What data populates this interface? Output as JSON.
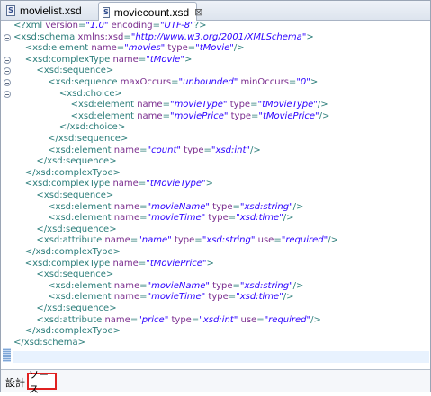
{
  "tabs": [
    {
      "label": "movielist.xsd",
      "icon": "xsd-file-icon",
      "active": false
    },
    {
      "label": "moviecount.xsd",
      "icon": "xsd-file-icon",
      "active": true,
      "close": "⊠"
    }
  ],
  "icon_letter": "S",
  "editor": {
    "lines": [
      [
        {
          "t": "plain",
          "v": "<?xml "
        },
        {
          "t": "attr",
          "v": "version"
        },
        {
          "t": "plain",
          "v": "="
        },
        {
          "t": "val",
          "v": "\"1.0\""
        },
        {
          "t": "plain",
          "v": " "
        },
        {
          "t": "attr",
          "v": "encoding"
        },
        {
          "t": "plain",
          "v": "="
        },
        {
          "t": "val",
          "v": "\"UTF-8\""
        },
        {
          "t": "plain",
          "v": "?>"
        }
      ],
      [
        {
          "t": "tag",
          "v": "<xsd:schema "
        },
        {
          "t": "attr",
          "v": "xmlns:xsd"
        },
        {
          "t": "plain",
          "v": "="
        },
        {
          "t": "val",
          "v": "\"http://www.w3.org/2001/XMLSchema\""
        },
        {
          "t": "tag",
          "v": ">"
        }
      ],
      [
        {
          "t": "tag",
          "v": "    <xsd:element "
        },
        {
          "t": "attr",
          "v": "name"
        },
        {
          "t": "plain",
          "v": "="
        },
        {
          "t": "val",
          "v": "\"movies\""
        },
        {
          "t": "plain",
          "v": " "
        },
        {
          "t": "attr",
          "v": "type"
        },
        {
          "t": "plain",
          "v": "="
        },
        {
          "t": "val",
          "v": "\"tMovie\""
        },
        {
          "t": "tag",
          "v": "/>"
        }
      ],
      [
        {
          "t": "tag",
          "v": "    <xsd:complexType "
        },
        {
          "t": "attr",
          "v": "name"
        },
        {
          "t": "plain",
          "v": "="
        },
        {
          "t": "val",
          "v": "\"tMovie\""
        },
        {
          "t": "tag",
          "v": ">"
        }
      ],
      [
        {
          "t": "tag",
          "v": "        <xsd:sequence>"
        }
      ],
      [
        {
          "t": "tag",
          "v": "            <xsd:sequence "
        },
        {
          "t": "attr",
          "v": "maxOccurs"
        },
        {
          "t": "plain",
          "v": "="
        },
        {
          "t": "val",
          "v": "\"unbounded\""
        },
        {
          "t": "plain",
          "v": " "
        },
        {
          "t": "attr",
          "v": "minOccurs"
        },
        {
          "t": "plain",
          "v": "="
        },
        {
          "t": "val",
          "v": "\"0\""
        },
        {
          "t": "tag",
          "v": ">"
        }
      ],
      [
        {
          "t": "tag",
          "v": "                <xsd:choice>"
        }
      ],
      [
        {
          "t": "tag",
          "v": "                    <xsd:element "
        },
        {
          "t": "attr",
          "v": "name"
        },
        {
          "t": "plain",
          "v": "="
        },
        {
          "t": "val",
          "v": "\"movieType\""
        },
        {
          "t": "plain",
          "v": " "
        },
        {
          "t": "attr",
          "v": "type"
        },
        {
          "t": "plain",
          "v": "="
        },
        {
          "t": "val",
          "v": "\"tMovieType\""
        },
        {
          "t": "tag",
          "v": "/>"
        }
      ],
      [
        {
          "t": "tag",
          "v": "                    <xsd:element "
        },
        {
          "t": "attr",
          "v": "name"
        },
        {
          "t": "plain",
          "v": "="
        },
        {
          "t": "val",
          "v": "\"moviePrice\""
        },
        {
          "t": "plain",
          "v": " "
        },
        {
          "t": "attr",
          "v": "type"
        },
        {
          "t": "plain",
          "v": "="
        },
        {
          "t": "val",
          "v": "\"tMoviePrice\""
        },
        {
          "t": "tag",
          "v": "/>"
        }
      ],
      [
        {
          "t": "tag",
          "v": "                </xsd:choice>"
        }
      ],
      [
        {
          "t": "tag",
          "v": "            </xsd:sequence>"
        }
      ],
      [
        {
          "t": "tag",
          "v": "            <xsd:element "
        },
        {
          "t": "attr",
          "v": "name"
        },
        {
          "t": "plain",
          "v": "="
        },
        {
          "t": "val",
          "v": "\"count\""
        },
        {
          "t": "plain",
          "v": " "
        },
        {
          "t": "attr",
          "v": "type"
        },
        {
          "t": "plain",
          "v": "="
        },
        {
          "t": "val",
          "v": "\"xsd:int\""
        },
        {
          "t": "tag",
          "v": "/>"
        }
      ],
      [
        {
          "t": "tag",
          "v": "        </xsd:sequence>"
        }
      ],
      [
        {
          "t": "tag",
          "v": "    </xsd:complexType>"
        }
      ],
      [
        {
          "t": "tag",
          "v": "    <xsd:complexType "
        },
        {
          "t": "attr",
          "v": "name"
        },
        {
          "t": "plain",
          "v": "="
        },
        {
          "t": "val",
          "v": "\"tMovieType\""
        },
        {
          "t": "tag",
          "v": ">"
        }
      ],
      [
        {
          "t": "tag",
          "v": "        <xsd:sequence>"
        }
      ],
      [
        {
          "t": "tag",
          "v": "            <xsd:element "
        },
        {
          "t": "attr",
          "v": "name"
        },
        {
          "t": "plain",
          "v": "="
        },
        {
          "t": "val",
          "v": "\"movieName\""
        },
        {
          "t": "plain",
          "v": " "
        },
        {
          "t": "attr",
          "v": "type"
        },
        {
          "t": "plain",
          "v": "="
        },
        {
          "t": "val",
          "v": "\"xsd:string\""
        },
        {
          "t": "tag",
          "v": "/>"
        }
      ],
      [
        {
          "t": "tag",
          "v": "            <xsd:element "
        },
        {
          "t": "attr",
          "v": "name"
        },
        {
          "t": "plain",
          "v": "="
        },
        {
          "t": "val",
          "v": "\"movieTime\""
        },
        {
          "t": "plain",
          "v": " "
        },
        {
          "t": "attr",
          "v": "type"
        },
        {
          "t": "plain",
          "v": "="
        },
        {
          "t": "val",
          "v": "\"xsd:time\""
        },
        {
          "t": "tag",
          "v": "/>"
        }
      ],
      [
        {
          "t": "tag",
          "v": "        </xsd:sequence>"
        }
      ],
      [
        {
          "t": "tag",
          "v": "        <xsd:attribute "
        },
        {
          "t": "attr",
          "v": "name"
        },
        {
          "t": "plain",
          "v": "="
        },
        {
          "t": "val",
          "v": "\"name\""
        },
        {
          "t": "plain",
          "v": " "
        },
        {
          "t": "attr",
          "v": "type"
        },
        {
          "t": "plain",
          "v": "="
        },
        {
          "t": "val",
          "v": "\"xsd:string\""
        },
        {
          "t": "plain",
          "v": " "
        },
        {
          "t": "attr",
          "v": "use"
        },
        {
          "t": "plain",
          "v": "="
        },
        {
          "t": "val",
          "v": "\"required\""
        },
        {
          "t": "tag",
          "v": "/>"
        }
      ],
      [
        {
          "t": "tag",
          "v": "    </xsd:complexType>"
        }
      ],
      [
        {
          "t": "tag",
          "v": "    <xsd:complexType "
        },
        {
          "t": "attr",
          "v": "name"
        },
        {
          "t": "plain",
          "v": "="
        },
        {
          "t": "val",
          "v": "\"tMoviePrice\""
        },
        {
          "t": "tag",
          "v": ">"
        }
      ],
      [
        {
          "t": "tag",
          "v": "        <xsd:sequence>"
        }
      ],
      [
        {
          "t": "tag",
          "v": "            <xsd:element "
        },
        {
          "t": "attr",
          "v": "name"
        },
        {
          "t": "plain",
          "v": "="
        },
        {
          "t": "val",
          "v": "\"movieName\""
        },
        {
          "t": "plain",
          "v": " "
        },
        {
          "t": "attr",
          "v": "type"
        },
        {
          "t": "plain",
          "v": "="
        },
        {
          "t": "val",
          "v": "\"xsd:string\""
        },
        {
          "t": "tag",
          "v": "/>"
        }
      ],
      [
        {
          "t": "tag",
          "v": "            <xsd:element "
        },
        {
          "t": "attr",
          "v": "name"
        },
        {
          "t": "plain",
          "v": "="
        },
        {
          "t": "val",
          "v": "\"movieTime\""
        },
        {
          "t": "plain",
          "v": " "
        },
        {
          "t": "attr",
          "v": "type"
        },
        {
          "t": "plain",
          "v": "="
        },
        {
          "t": "val",
          "v": "\"xsd:time\""
        },
        {
          "t": "tag",
          "v": "/>"
        }
      ],
      [
        {
          "t": "tag",
          "v": "        </xsd:sequence>"
        }
      ],
      [
        {
          "t": "tag",
          "v": "        <xsd:attribute "
        },
        {
          "t": "attr",
          "v": "name"
        },
        {
          "t": "plain",
          "v": "="
        },
        {
          "t": "val",
          "v": "\"price\""
        },
        {
          "t": "plain",
          "v": " "
        },
        {
          "t": "attr",
          "v": "type"
        },
        {
          "t": "plain",
          "v": "="
        },
        {
          "t": "val",
          "v": "\"xsd:int\""
        },
        {
          "t": "plain",
          "v": " "
        },
        {
          "t": "attr",
          "v": "use"
        },
        {
          "t": "plain",
          "v": "="
        },
        {
          "t": "val",
          "v": "\"required\""
        },
        {
          "t": "tag",
          "v": "/>"
        }
      ],
      [
        {
          "t": "tag",
          "v": "    </xsd:complexType>"
        }
      ],
      [
        {
          "t": "tag",
          "v": "</xsd:schema>"
        }
      ]
    ],
    "fold_lines": [
      1,
      3,
      4,
      5,
      6
    ],
    "colors": {
      "tag": "#2b7d7a",
      "attr": "#7a2d8e",
      "value": "#2a00ff"
    }
  },
  "bottom_tabs": {
    "design": "設計",
    "source": "ソース",
    "highlight_color": "#e02020"
  }
}
